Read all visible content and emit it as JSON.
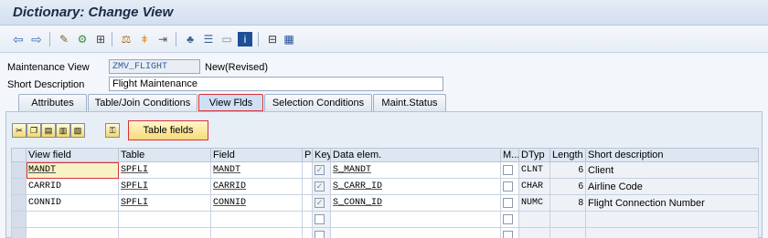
{
  "window": {
    "title": "Dictionary: Change View"
  },
  "toolbar": {
    "icons": [
      "back-arrow-icon",
      "forward-arrow-icon",
      "display-change-icon",
      "other-object-icon",
      "activate-icon",
      "check-icon",
      "activate-object-icon",
      "where-used-icon",
      "object-list-icon",
      "display-object-list-icon",
      "navigation-icon",
      "hierarchy-icon",
      "technical-settings-icon"
    ]
  },
  "form": {
    "maintenance_view_label": "Maintenance View",
    "maintenance_view_value": "ZMV_FLIGHT",
    "maintenance_view_status": "New(Revised)",
    "short_desc_label": "Short Description",
    "short_desc_value": "Flight Maintenance"
  },
  "tabs": [
    {
      "label": "Attributes"
    },
    {
      "label": "Table/Join Conditions"
    },
    {
      "label": "View Flds"
    },
    {
      "label": "Selection Conditions"
    },
    {
      "label": "Maint.Status"
    }
  ],
  "panel": {
    "table_fields_label": "Table fields"
  },
  "grid": {
    "headers": [
      "View field",
      "Table",
      "Field",
      "P",
      "Key",
      "Data elem.",
      "M...",
      "DTyp",
      "Length",
      "Short description"
    ],
    "rows": [
      {
        "view_field": "MANDT",
        "table": "SPFLI",
        "field": "MANDT",
        "key": true,
        "data_elem": "S_MANDT",
        "dtyp": "CLNT",
        "length": "6",
        "desc": "Client"
      },
      {
        "view_field": "CARRID",
        "table": "SPFLI",
        "field": "CARRID",
        "key": true,
        "data_elem": "S_CARR_ID",
        "dtyp": "CHAR",
        "length": "6",
        "desc": "Airline Code"
      },
      {
        "view_field": "CONNID",
        "table": "SPFLI",
        "field": "CONNID",
        "key": true,
        "data_elem": "S_CONN_ID",
        "dtyp": "NUMC",
        "length": "8",
        "desc": "Flight Connection Number"
      },
      {
        "view_field": "",
        "table": "",
        "field": "",
        "key": false,
        "data_elem": "",
        "dtyp": "",
        "length": "",
        "desc": ""
      },
      {
        "view_field": "",
        "table": "",
        "field": "",
        "key": false,
        "data_elem": "",
        "dtyp": "",
        "length": "",
        "desc": ""
      }
    ]
  }
}
